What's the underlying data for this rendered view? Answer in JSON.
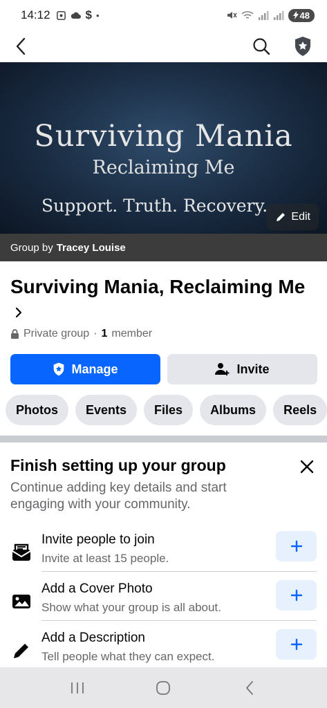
{
  "status_bar": {
    "time": "14:12",
    "currency_glyph": "$",
    "dot": "•",
    "battery": "48"
  },
  "cover": {
    "title": "Surviving Mania",
    "subtitle": "Reclaiming Me",
    "tagline": "Support. Truth. Recovery.",
    "edit_label": "Edit",
    "bg_color": "#1b2e45"
  },
  "group_by": {
    "prefix": "Group by",
    "owner": "Tracey Louise"
  },
  "group": {
    "name": "Surviving Mania, Reclaiming Me",
    "privacy": "Private group",
    "separator": "·",
    "member_count": "1",
    "member_label": "member"
  },
  "actions": {
    "manage_label": "Manage",
    "invite_label": "Invite",
    "accent": "#0866ff"
  },
  "tabs": [
    "Photos",
    "Events",
    "Files",
    "Albums",
    "Reels"
  ],
  "setup": {
    "title": "Finish setting up your group",
    "description": "Continue adding key details and start engaging with your community.",
    "tasks": [
      {
        "icon": "envelope-icon",
        "title": "Invite people to join",
        "subtitle": "Invite at least 15 people."
      },
      {
        "icon": "image-icon",
        "title": "Add a Cover Photo",
        "subtitle": "Show what your group is all about."
      },
      {
        "icon": "pencil-icon",
        "title": "Add a Description",
        "subtitle": "Tell people what they can expect."
      }
    ]
  },
  "icons": {
    "back": "chevron-left-icon",
    "search": "search-icon",
    "admin": "admin-shield-icon",
    "close": "close-icon",
    "add": "plus-icon"
  }
}
